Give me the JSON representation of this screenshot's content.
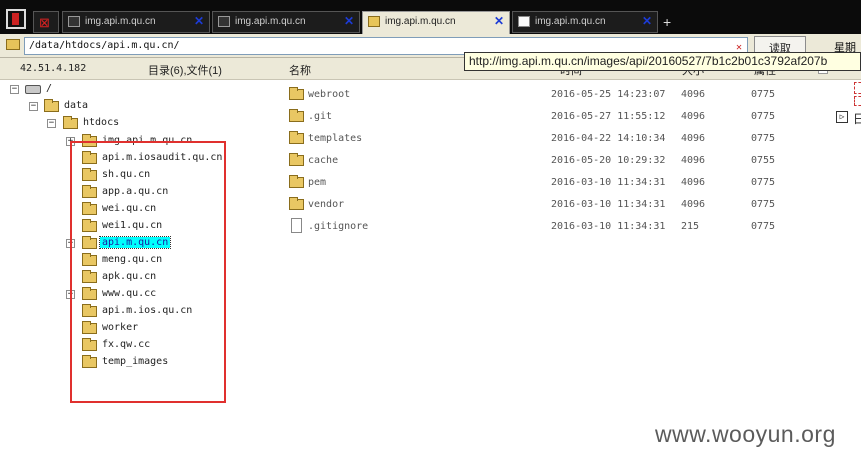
{
  "tabs": [
    {
      "label": "img.api.m.qu.cn",
      "active": false
    },
    {
      "label": "img.api.m.qu.cn",
      "active": false
    },
    {
      "label": "img.api.m.qu.cn",
      "active": true
    },
    {
      "label": "img.api.m.qu.cn",
      "active": false
    }
  ],
  "new_tab": "+",
  "address": {
    "path": "/data/htdocs/api.m.qu.cn/",
    "go_label": "读取",
    "side_label": "星期五"
  },
  "info": {
    "server_ip": "42.51.4.182",
    "dir_summary": "目录(6),文件(1)",
    "col_name": "名称",
    "col_time": "时间",
    "col_size": "大小",
    "col_attr": "属性"
  },
  "tooltip": "http://img.api.m.qu.cn/images/api/20160527/7b1c2b01c3792af207b",
  "tree": {
    "root": "/",
    "data": "data",
    "htdocs": "htdocs",
    "children": [
      "img.api.m.qu.cn",
      "api.m.iosaudit.qu.cn",
      "sh.qu.cn",
      "app.a.qu.cn",
      "wei.qu.cn",
      "wei1.qu.cn",
      "api.m.qu.cn",
      "meng.qu.cn",
      "apk.qu.cn",
      "www.qu.cc",
      "api.m.ios.qu.cn",
      "worker",
      "fx.qw.cc",
      "temp_images"
    ]
  },
  "files": [
    {
      "name": "webroot",
      "time": "2016-05-25 14:23:07",
      "size": "4096",
      "attr": "0775",
      "type": "folder"
    },
    {
      "name": ".git",
      "time": "2016-05-27 11:55:12",
      "size": "4096",
      "attr": "0775",
      "type": "folder"
    },
    {
      "name": "templates",
      "time": "2016-04-22 14:10:34",
      "size": "4096",
      "attr": "0775",
      "type": "folder"
    },
    {
      "name": "cache",
      "time": "2016-05-20 10:29:32",
      "size": "4096",
      "attr": "0755",
      "type": "folder"
    },
    {
      "name": "pem",
      "time": "2016-03-10 11:34:31",
      "size": "4096",
      "attr": "0775",
      "type": "folder"
    },
    {
      "name": "vendor",
      "time": "2016-03-10 11:34:31",
      "size": "4096",
      "attr": "0775",
      "type": "folder"
    },
    {
      "name": ".gitignore",
      "time": "2016-03-10 11:34:31",
      "size": "215",
      "attr": "0775",
      "type": "file"
    }
  ],
  "right_edge_char": "日",
  "watermark": "www.wooyun.org",
  "colors": {
    "highlight_box": "#e0302e",
    "selection": "#00ffff",
    "folder": "#e9c763"
  }
}
